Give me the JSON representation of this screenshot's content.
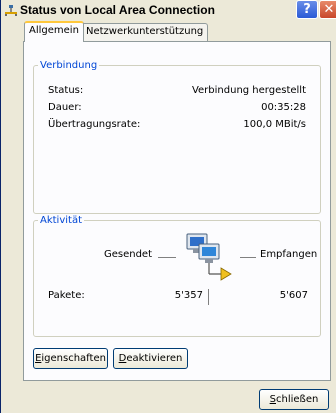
{
  "window": {
    "title": "Status von Local Area Connection",
    "help_glyph": "?",
    "close_glyph": "✕"
  },
  "tabs": [
    {
      "label": "Allgemein",
      "active": true
    },
    {
      "label": "Netzwerkunterstützung",
      "active": false
    }
  ],
  "connection": {
    "group_label": "Verbindung",
    "rows": [
      {
        "label": "Status:",
        "value": "Verbindung hergestellt"
      },
      {
        "label": "Dauer:",
        "value": "00:35:28"
      },
      {
        "label": "Übertragungsrate:",
        "value": "100,0 MBit/s"
      }
    ]
  },
  "activity": {
    "group_label": "Aktivität",
    "sent_label": "Gesendet",
    "received_label": "Empfangen",
    "packets_label": "Pakete:",
    "packets_sent": "5'357",
    "packets_received": "5'607"
  },
  "buttons": {
    "properties_accel": "E",
    "properties_rest": "igenschaften",
    "deactivate_accel": "D",
    "deactivate_rest": "eaktivieren",
    "close_accel": "S",
    "close_rest": "chließen"
  }
}
